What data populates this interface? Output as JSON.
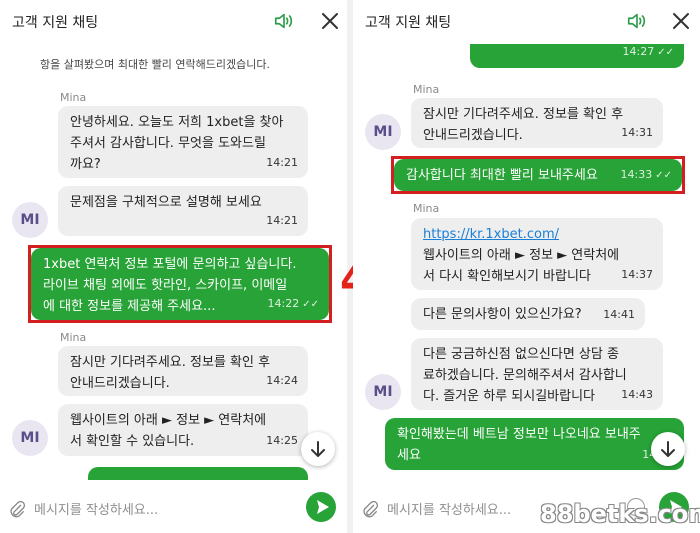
{
  "header": {
    "title": "고객 지원 채팅"
  },
  "left": {
    "notice_text": "항을 살펴봤으며 최대한 빨리 연락해드리겠습니다.",
    "sender_1": "Mina",
    "msg_1": {
      "text": "안녕하세요. 오늘도 저희 1xbet을 찾아\n주셔서 감사합니다. 무엇을 도와드릴\n까요?",
      "time": "14:21"
    },
    "msg_2": {
      "text": "문제점을 구체적으로 설명해 보세요",
      "time": "14:21"
    },
    "avatar_1": "MI",
    "msg_3": {
      "text": "1xbet 연락처 정보 포털에 문의하고 싶습니다.\n라이브 채팅 외에도 핫라인, 스카이프, 이메일\n에 대한 정보를 제공해 주세요...",
      "time": "14:22",
      "ticks": "✓✓"
    },
    "sender_2": "Mina",
    "msg_4": {
      "text": "잠시만 기다려주세요. 정보를 확인 후\n안내드리겠습니다.",
      "time": "14:24"
    },
    "msg_5": {
      "text": "웹사이트의 아래 ► 정보 ► 연락처에\n서 확인할 수 있습니다.",
      "time": "14:25"
    },
    "avatar_2": "MI"
  },
  "step_number": "4",
  "right": {
    "top_out_time": "14:27",
    "top_out_ticks": "✓✓",
    "sender_1": "Mina",
    "msg_1": {
      "text": "잠시만 기다려주세요. 정보를 확인 후\n안내드리겠습니다.",
      "time": "14:31"
    },
    "avatar_1": "MI",
    "msg_2": {
      "text": "감사합니다 최대한 빨리 보내주세요",
      "time": "14:33",
      "ticks": "✓✓"
    },
    "sender_2": "Mina",
    "msg_3": {
      "link": "https://kr.1xbet.com/",
      "text": "웹사이트의 아래 ► 정보 ► 연락처에\n서 다시 확인해보시기 바랍니다",
      "time": "14:37"
    },
    "msg_4": {
      "text": "다른 문의사항이 있으신가요?",
      "time": "14:41"
    },
    "msg_5": {
      "text": "다른 궁금하신점 없으신다면 상담 종\n료하겠습니다. 문의해주셔서 감사합니\n다. 즐거운 하루 되시길바랍니다",
      "time": "14:43"
    },
    "avatar_2": "MI",
    "msg_6": {
      "text": "확인해봤는데 베트남 정보만 나오네요 보내주\n세요",
      "time": "14:53"
    }
  },
  "composer": {
    "placeholder": "메시지를 작성하세요..."
  },
  "watermark": "88betks.com",
  "colors": {
    "outgoing": "#27a337",
    "incoming": "#eeeeee",
    "highlight": "#d31f1f",
    "avatar_bg": "#e9e6f2"
  }
}
